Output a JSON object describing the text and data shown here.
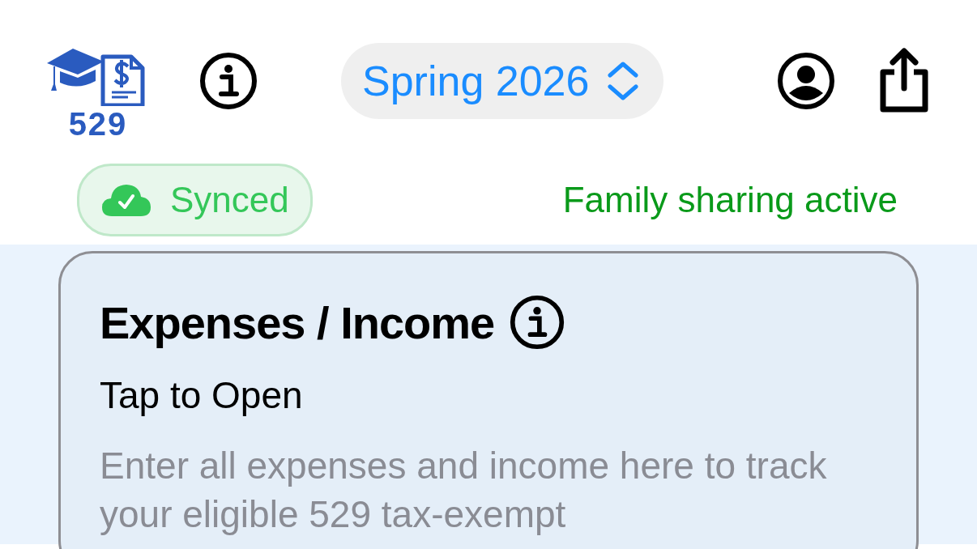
{
  "header": {
    "logo_text": "529",
    "term": "Spring 2026"
  },
  "sync": {
    "label": "Synced",
    "synced": true
  },
  "sharing": "Family sharing active",
  "card": {
    "title": "Expenses / Income",
    "subtitle": "Tap to Open",
    "description": "Enter all expenses and income here to track your eligible 529 tax-exempt"
  }
}
